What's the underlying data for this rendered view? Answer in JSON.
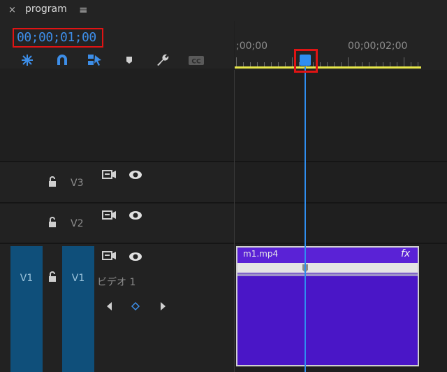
{
  "panel": {
    "close_glyph": "×",
    "title": "program",
    "menu_glyph": "≡"
  },
  "timecode": "00;00;01;00",
  "toolbar": {
    "icons": [
      "snap-icon",
      "magnet-icon",
      "linked-selection-icon",
      "marker-icon",
      "wrench-icon",
      "captions-icon"
    ]
  },
  "ruler": {
    "labels": [
      ";00;00",
      "00;00;02;00"
    ]
  },
  "tracks": [
    {
      "name": "V3"
    },
    {
      "name": "V2"
    },
    {
      "name": "V1",
      "target_label": "V1",
      "source_label": "V1",
      "sub_label": "ビデオ 1"
    }
  ],
  "clip": {
    "name": "m1.mp4",
    "fx": "fx"
  },
  "colors": {
    "accent": "#2f8ef0",
    "highlight": "#e01414",
    "clip": "#4a16c7",
    "work_area": "#e8e84a"
  }
}
